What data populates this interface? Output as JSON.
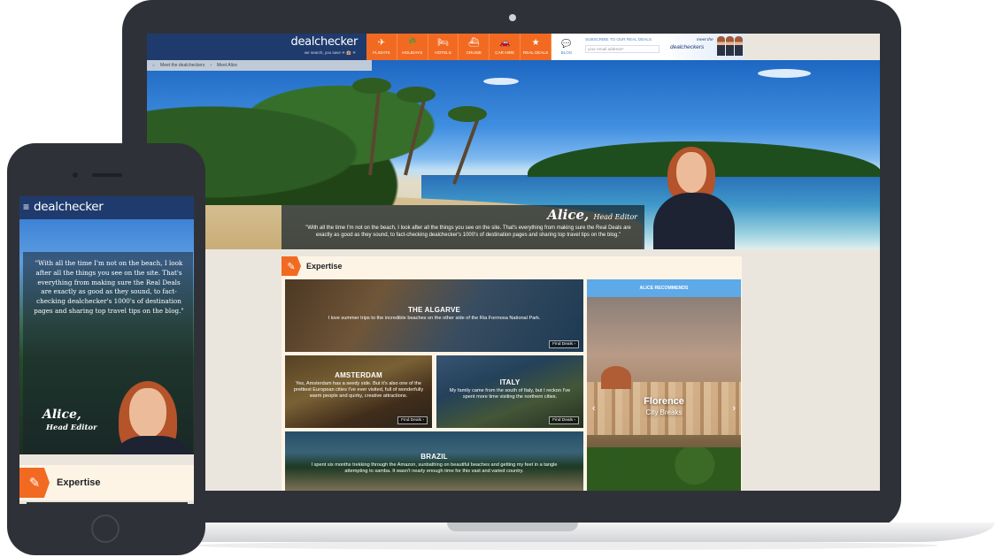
{
  "brand": {
    "name": "dealchecker",
    "tagline": "we search, you save ✈ 🏨 ☀"
  },
  "nav": {
    "items": [
      {
        "icon": "plane-icon",
        "glyph": "✈",
        "label": "FLIGHTS"
      },
      {
        "icon": "palm-icon",
        "glyph": "🌴",
        "label": "HOLIDAYS"
      },
      {
        "icon": "bed-icon",
        "glyph": "🛏",
        "label": "HOTELS"
      },
      {
        "icon": "ship-icon",
        "glyph": "⛴",
        "label": "CRUISE"
      },
      {
        "icon": "car-icon",
        "glyph": "🚗",
        "label": "CAR HIRE"
      },
      {
        "icon": "star-icon",
        "glyph": "★",
        "label": "REAL DEALS"
      }
    ],
    "blog_label": "BLOG",
    "subscribe_label": "SUBSCRIBE TO OUR REAL DEALS",
    "email_placeholder": "your email address*",
    "meet_line1": "meet the",
    "meet_line2": "dealcheckers"
  },
  "breadcrumb": {
    "items": [
      "Meet the dealcheckers",
      "Meet Alice"
    ]
  },
  "profile": {
    "name": "Alice,",
    "role": "Head Editor",
    "quote": "\"With all the time I'm not on the beach, I look after all the things you see on the site. That's everything from making sure the Real Deals are exactly as good as they sound, to fact-checking dealchecker's 1000's of destination pages and sharing top travel tips on the blog.\""
  },
  "expertise": {
    "title": "Expertise",
    "tiles": [
      {
        "title": "THE ALGARVE",
        "text": "I love summer trips to the incredible beaches on the other side of the Ria Formosa National Park.",
        "button": "Find Deals ›"
      },
      {
        "title": "AMSTERDAM",
        "text": "Yes, Amsterdam has a seedy side. But it's also one of the prettiest European cities I've ever visited, full of wonderfully warm people and quirky, creative attractions.",
        "button": "Find Deals ›"
      },
      {
        "title": "ITALY",
        "text": "My family came from the south of Italy, but I reckon I've spent more time visiting the northern cities.",
        "button": "Find Deals ›"
      },
      {
        "title": "BRAZIL",
        "text": "I spent six months trekking through the Amazon, sunbathing on beautiful beaches and getting my feet in a tangle attempting to samba. It wasn't nearly enough time for this vast and varied country.",
        "button": ""
      }
    ]
  },
  "recommends": {
    "heading": "ALICE RECOMMENDS",
    "city": "Florence",
    "subtitle": "City Breaks",
    "prev": "‹",
    "next": "›"
  },
  "mobile": {
    "menu_glyph": "≡",
    "expertise_icon": "✎"
  },
  "colors": {
    "brand_navy": "#1f3b6d",
    "accent_orange": "#f26a21",
    "recommend_blue": "#5ea9e8"
  }
}
